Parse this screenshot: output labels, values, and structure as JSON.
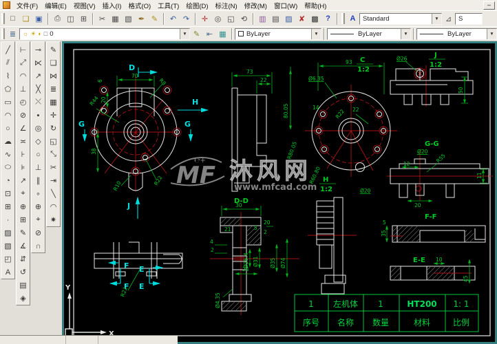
{
  "window": {
    "minimize": "–"
  },
  "menubar": {
    "items": [
      "文件(F)",
      "编辑(E)",
      "视图(V)",
      "插入(I)",
      "格式(O)",
      "工具(T)",
      "绘图(D)",
      "标注(N)",
      "修改(M)",
      "窗口(W)",
      "帮助(H)"
    ]
  },
  "standard_toolbar": {
    "file_icons": [
      {
        "name": "new-file",
        "glyph": "□"
      },
      {
        "name": "open-file",
        "glyph": "❏",
        "color": "#b08a20"
      },
      {
        "name": "save",
        "glyph": "▣",
        "color": "#3a5fa8"
      }
    ],
    "print_icons": [
      {
        "name": "plot",
        "glyph": "⎙"
      },
      {
        "name": "plot-preview",
        "glyph": "◫"
      },
      {
        "name": "publish",
        "glyph": "⊞"
      }
    ],
    "edit_icons": [
      {
        "name": "cut",
        "glyph": "✂"
      },
      {
        "name": "copy-clip",
        "glyph": "▦"
      },
      {
        "name": "paste",
        "glyph": "▧"
      },
      {
        "name": "match-properties",
        "glyph": "✒",
        "color": "#8a6a20"
      },
      {
        "name": "block-editor",
        "glyph": "✎",
        "color": "#b09020"
      }
    ],
    "undo_icons": [
      {
        "name": "undo",
        "glyph": "↶",
        "color": "#3a5fa8"
      },
      {
        "name": "redo",
        "glyph": "↷",
        "color": "#3a5fa8"
      }
    ],
    "zoom_icons": [
      {
        "name": "pan-realtime",
        "glyph": "✛",
        "color": "#b03030"
      },
      {
        "name": "zoom-realtime",
        "glyph": "◎"
      },
      {
        "name": "zoom-window",
        "glyph": "◱"
      },
      {
        "name": "zoom-previous",
        "glyph": "⟲"
      }
    ],
    "palette_icons": [
      {
        "name": "designcenter",
        "glyph": "▥",
        "color": "#8a5a9a"
      },
      {
        "name": "tool-palettes",
        "glyph": "▤"
      },
      {
        "name": "sheet-set-manager",
        "glyph": "▨",
        "color": "#3a5fa8"
      },
      {
        "name": "markup-set-manager",
        "glyph": "✘",
        "color": "#b03030"
      },
      {
        "name": "quickcalc",
        "glyph": "▩",
        "color": "#303030"
      }
    ],
    "help_glyph": "?",
    "text_style_glyph": "A",
    "style_combo_value": "Standard",
    "dim_style_glyph": "⊿",
    "clipped_combo_value": "S"
  },
  "properties_toolbar": {
    "layers_glyph": "≣",
    "layer_combo_icons": [
      {
        "name": "layer-on-bulb",
        "glyph": "☼",
        "color": "#c8a000"
      },
      {
        "name": "layer-thaw-sun",
        "glyph": "☀",
        "color": "#c8a000"
      },
      {
        "name": "layer-lock",
        "glyph": "◐",
        "color": "#c8a000"
      },
      {
        "name": "layer-color-swatch",
        "glyph": "□",
        "color": "#555555"
      }
    ],
    "layer_combo_value": "0",
    "layer_icons": [
      {
        "name": "make-object-layer-current",
        "glyph": "✎",
        "color": "#7a8a30"
      },
      {
        "name": "layer-previous",
        "glyph": "⇤",
        "color": "#4a6a90"
      },
      {
        "name": "layer-states",
        "glyph": "▦",
        "color": "#2f8f8f"
      }
    ],
    "color_combo_value": "ByLayer",
    "linetype_combo_value": "ByLayer",
    "lineweight_combo_value": "ByLayer"
  },
  "tool_palettes": {
    "draw": [
      {
        "name": "line",
        "glyph": "╱"
      },
      {
        "name": "construction-line",
        "glyph": "⫽"
      },
      {
        "name": "polyline",
        "glyph": "⌇"
      },
      {
        "name": "polygon",
        "glyph": "⬠"
      },
      {
        "name": "rectangle",
        "glyph": "▭"
      },
      {
        "name": "arc",
        "glyph": "◠"
      },
      {
        "name": "circle",
        "glyph": "○"
      },
      {
        "name": "revision-cloud",
        "glyph": "☁"
      },
      {
        "name": "spline",
        "glyph": "∿"
      },
      {
        "name": "ellipse",
        "glyph": "⬭"
      },
      {
        "name": "ellipse-arc",
        "glyph": "◔"
      },
      {
        "name": "insert-block",
        "glyph": "⊡"
      },
      {
        "name": "make-block",
        "glyph": "⊞"
      },
      {
        "name": "point",
        "glyph": "∙"
      },
      {
        "name": "hatch",
        "glyph": "▨"
      },
      {
        "name": "gradient",
        "glyph": "▧"
      },
      {
        "name": "region",
        "glyph": "◰"
      },
      {
        "name": "multiline-text",
        "glyph": "A"
      }
    ],
    "dimension": [
      {
        "name": "dim-linear",
        "glyph": "⊢"
      },
      {
        "name": "dim-aligned",
        "glyph": "⤢"
      },
      {
        "name": "dim-arc-length",
        "glyph": "◠"
      },
      {
        "name": "dim-ordinate",
        "glyph": "⊥"
      },
      {
        "name": "dim-radius",
        "glyph": "◴"
      },
      {
        "name": "dim-diameter",
        "glyph": "⊘"
      },
      {
        "name": "dim-angular",
        "glyph": "∠"
      },
      {
        "name": "quick-dim",
        "glyph": "≍"
      },
      {
        "name": "dim-baseline",
        "glyph": "⊦"
      },
      {
        "name": "dim-continue",
        "glyph": "⊧"
      },
      {
        "name": "quick-leader",
        "glyph": "↗"
      },
      {
        "name": "tolerance",
        "glyph": "⌖"
      },
      {
        "name": "center-mark",
        "glyph": "⊕"
      },
      {
        "name": "dim-jogged",
        "glyph": "⊞"
      },
      {
        "name": "dim-edit",
        "glyph": "✎"
      },
      {
        "name": "dim-text-angle",
        "glyph": "∡"
      },
      {
        "name": "dim-text-edit",
        "glyph": "⇵"
      },
      {
        "name": "dim-update",
        "glyph": "↺"
      },
      {
        "name": "dim-style-manager",
        "glyph": "▤"
      },
      {
        "name": "dim-override",
        "glyph": "◈"
      }
    ],
    "osnap": [
      {
        "name": "snap-from",
        "glyph": "⊸"
      },
      {
        "name": "snap-endpoint",
        "glyph": "⋉"
      },
      {
        "name": "snap-midpoint",
        "glyph": "↗"
      },
      {
        "name": "snap-intersection",
        "glyph": "╳"
      },
      {
        "name": "snap-apparent-intersection",
        "glyph": "⤬"
      },
      {
        "name": "snap-extension",
        "glyph": "▪"
      },
      {
        "name": "snap-center",
        "glyph": "◎"
      },
      {
        "name": "snap-quadrant",
        "glyph": "◇"
      },
      {
        "name": "snap-tangent",
        "glyph": "○"
      },
      {
        "name": "snap-perpendicular",
        "glyph": "⊥"
      },
      {
        "name": "snap-parallel",
        "glyph": "∥"
      },
      {
        "name": "snap-node",
        "glyph": "∘"
      },
      {
        "name": "snap-insert",
        "glyph": "⊕"
      },
      {
        "name": "snap-nearest",
        "glyph": "⌖"
      },
      {
        "name": "snap-none",
        "glyph": "⊘"
      },
      {
        "name": "osnap-settings",
        "glyph": "∩"
      }
    ],
    "modify": [
      {
        "name": "erase",
        "glyph": "✎"
      },
      {
        "name": "copy-object",
        "glyph": "❏"
      },
      {
        "name": "mirror",
        "glyph": "⋈"
      },
      {
        "name": "offset",
        "glyph": "≣"
      },
      {
        "name": "array",
        "glyph": "▦"
      },
      {
        "name": "move",
        "glyph": "✛"
      },
      {
        "name": "rotate",
        "glyph": "↻"
      },
      {
        "name": "scale",
        "glyph": "◱"
      },
      {
        "name": "stretch",
        "glyph": "⤡"
      },
      {
        "name": "trim",
        "glyph": "✂"
      },
      {
        "name": "extend",
        "glyph": "⇥"
      },
      {
        "name": "chamfer",
        "glyph": "╲"
      },
      {
        "name": "fillet",
        "glyph": "◠"
      },
      {
        "name": "explode",
        "glyph": "✷"
      }
    ]
  },
  "drawing": {
    "views": {
      "main": {
        "letter_d": "D",
        "letter_g_left": "G",
        "letter_g_right": "G",
        "letter_h": "H",
        "letter_j": "J",
        "dim_70": "70",
        "dim_6": "6",
        "dim_20": "20",
        "dim_r44": "R44",
        "dim_r8": "R8",
        "dim_38": "38",
        "dim_r10": "R10",
        "dim_r22": "R22"
      },
      "side": {
        "dim_73": "73",
        "dim_22": "22"
      },
      "c": {
        "label": "C",
        "scale": "1:2",
        "dim_93": "93",
        "dim_dia635": "Ø6.35",
        "dim_8005": "80.05",
        "dim_14": "14",
        "dim_22": "22",
        "dim_r22": "R22",
        "dim_r8005": "R80.05",
        "dim_r6080": "R60.80",
        "dim_dia20": "Ø20"
      },
      "h": {
        "label": "H",
        "scale": "1:2"
      },
      "j": {
        "label": "J",
        "scale": "1:2",
        "dim_dia26": "Ø26",
        "dim_50": "50"
      },
      "gg": {
        "label": "G-G",
        "dim_dia20": "Ø20",
        "dim_r55": "R55",
        "dim_12": "12",
        "dim_11": "11",
        "dim_20": "20"
      },
      "ef": {
        "letter_f": "F",
        "letter_e": "E",
        "dim_r22": "R22"
      },
      "dd": {
        "label": "D-D",
        "dim_30": "30",
        "dim_20": "20",
        "dim_21": "21",
        "dim_5": "5",
        "dim_2a": "2",
        "dim_4": "4",
        "dim_2b": "2",
        "dim_24": "24",
        "dim_dia254": "Ø25.4",
        "dim_dia31": "Ø31",
        "dim_dia35": "Ø35",
        "dim_dia74": "Ø74",
        "dim_dia435": "Ø4.35"
      },
      "ff": {
        "label": "F-F",
        "dim_35": "35",
        "dim_5": "5"
      },
      "ee": {
        "label": "E-E",
        "dim_10": "10",
        "dim_45": "45"
      }
    },
    "title_block": {
      "row1": [
        "1",
        "左机体",
        "1",
        "HT200",
        "1: 1"
      ],
      "row2": [
        "序号",
        "名称",
        "数量",
        "材料",
        "比例"
      ]
    },
    "watermark": {
      "logo": "MF",
      "logo_super": "℮+",
      "name": "沐风网",
      "url": "www.mfcad.com"
    },
    "ucs": {
      "x": "X",
      "y": "Y"
    }
  },
  "colors": {
    "canvas": "#000000",
    "frame": "#e8e8e8",
    "dimension": "#00cc22",
    "centerline": "#a81414",
    "section": "#00e0e0",
    "table": "#00d23c",
    "watermark": "#9a9a9a",
    "border": "#36817f"
  }
}
